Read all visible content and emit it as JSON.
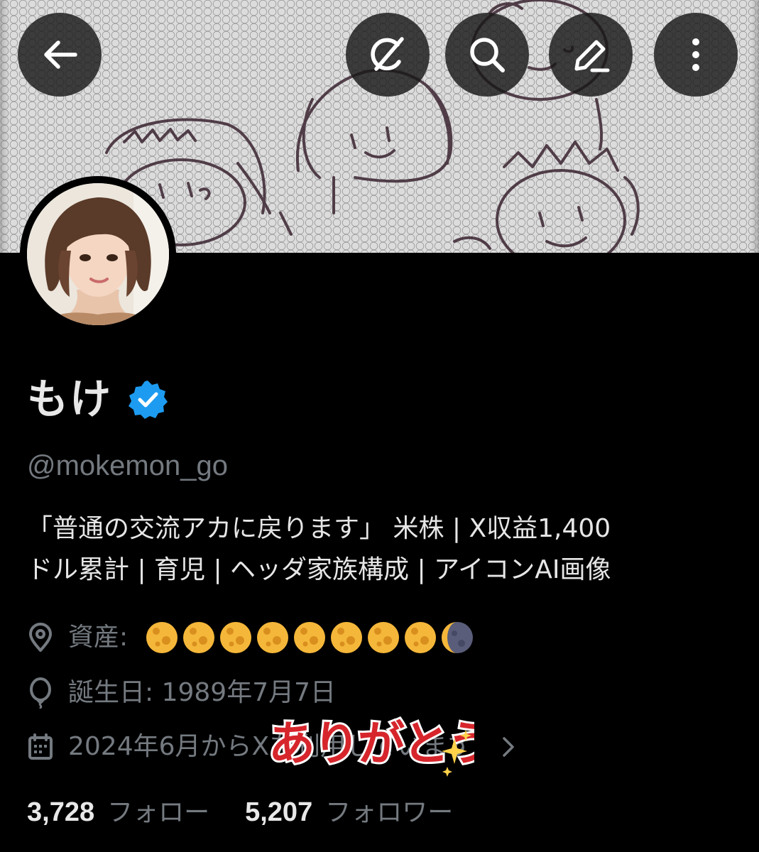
{
  "profile": {
    "display_name": "もけ",
    "handle": "@mokemon_go",
    "bio_line1": "「普通の交流アカに戻ります」 米株 | X収益1,400",
    "bio_line2": "ドル累計 | 育児 | ヘッダ家族構成 | アイコンAI画像",
    "location_label": "資産:",
    "location_moons": [
      "full-moon",
      "full-moon",
      "full-moon",
      "full-moon",
      "full-moon",
      "full-moon",
      "full-moon",
      "full-moon",
      "waning-crescent-moon"
    ],
    "birthday": "誕生日: 1989年7月7日",
    "joined": "2024年6月からXを利用しています",
    "following_count": "3,728",
    "following_label": "フォロー",
    "followers_count": "5,207",
    "followers_label": "フォロワー",
    "verified": true
  },
  "header_buttons": [
    {
      "icon": "back-arrow-icon"
    },
    {
      "icon": "grok-icon"
    },
    {
      "icon": "search-icon"
    },
    {
      "icon": "edit-icon"
    },
    {
      "icon": "more-vertical-icon"
    }
  ],
  "overlay_sticker": {
    "text": "ありがとう"
  },
  "colors": {
    "background": "#000000",
    "primary_text": "#e8e8e8",
    "secondary_text": "#747a80",
    "verified_badge": "#1d9bf0",
    "sticker_red": "#d6262c"
  }
}
